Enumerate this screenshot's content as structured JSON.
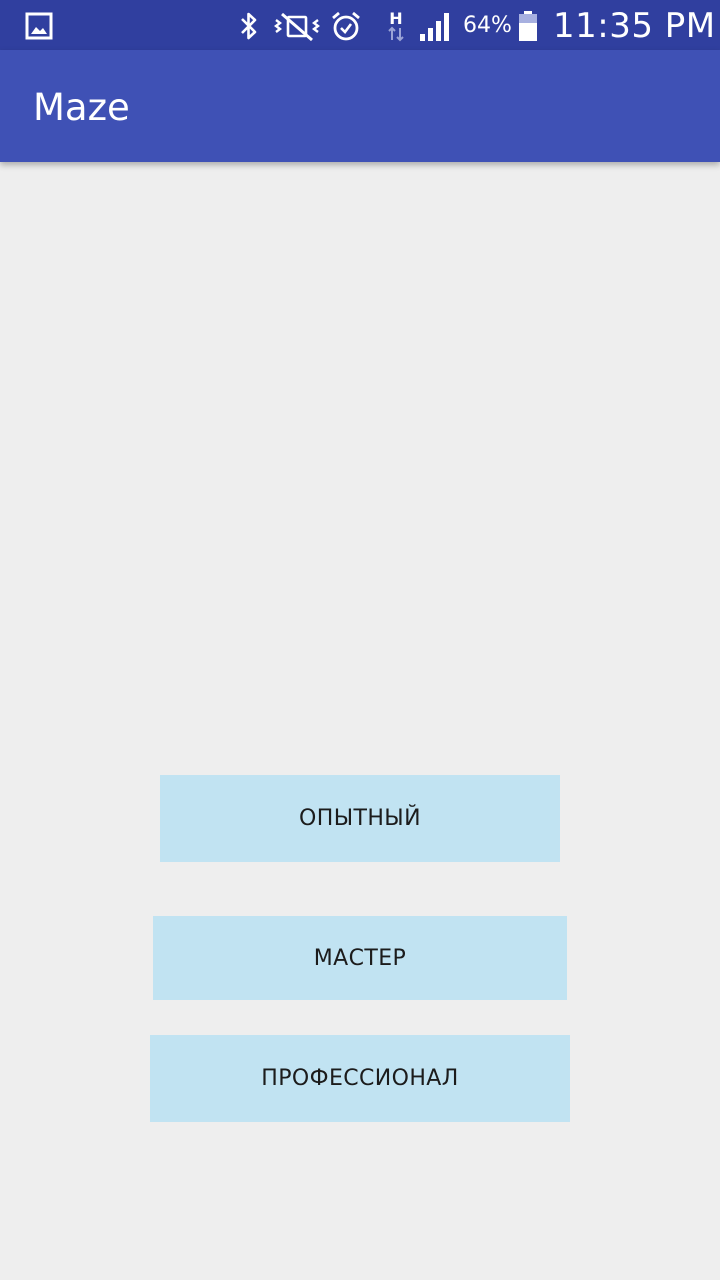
{
  "status_bar": {
    "battery_percent": "64%",
    "time": "11:35 PM",
    "icons": [
      "gallery-icon",
      "bluetooth-icon",
      "vibrate-icon",
      "alarm-icon",
      "network-h-icon",
      "signal-icon",
      "battery-icon"
    ]
  },
  "app_bar": {
    "title": "Maze"
  },
  "levels": {
    "experienced": "ОПЫТНЫЙ",
    "master": "МАСТЕР",
    "professional": "ПРОФЕССИОНАЛ"
  },
  "colors": {
    "status_bar": "#303f9f",
    "app_bar": "#3f51b5",
    "background": "#eeeeee",
    "button": "#c1e3f2"
  }
}
